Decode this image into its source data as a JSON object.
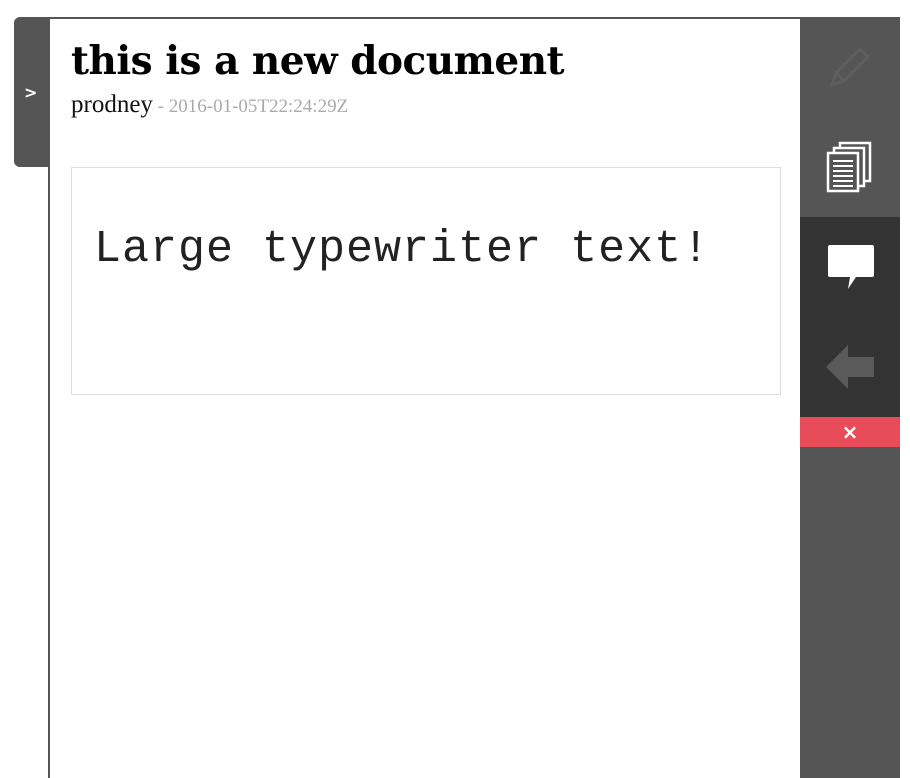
{
  "side_tab": {
    "label": ">"
  },
  "document": {
    "title": "this is a new document",
    "author": "prodney",
    "separator": " - ",
    "timestamp": "2016-01-05T22:24:29Z",
    "body_text": "Large typewriter text!"
  },
  "toolbar": {
    "edit_icon": "pencil-icon",
    "copy_icon": "documents-icon",
    "comment_icon": "speech-bubble-icon",
    "back_icon": "arrow-left-icon",
    "close_label": "×",
    "close_color": "#e84c59"
  },
  "colors": {
    "toolbar_bg": "#555555",
    "toolbar_active_bg": "#333333",
    "text": "#000000",
    "muted": "#aaaaaa"
  }
}
